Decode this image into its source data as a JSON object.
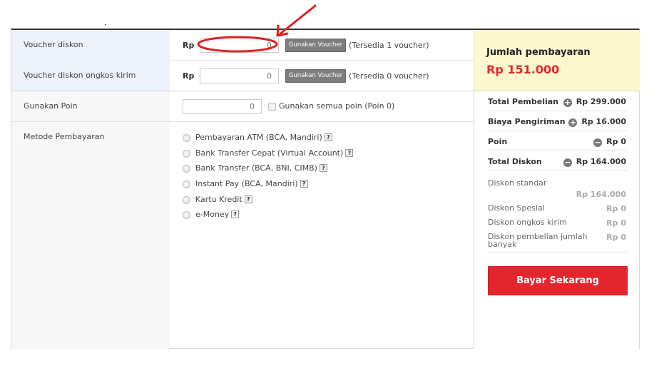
{
  "voucher": {
    "label": "Voucher diskon",
    "currency": "Rp",
    "value": "0",
    "button": "Gunakan Voucher",
    "note": "(Tersedia 1 voucher)"
  },
  "shipping_voucher": {
    "label": "Voucher diskon ongkos kirim",
    "currency": "Rp",
    "value": "0",
    "button": "Gunakan Voucher",
    "note": "(Tersedia 0 voucher)"
  },
  "points": {
    "label": "Gunakan Poin",
    "value": "0",
    "checkbox_label": "Gunakan semua poin (Poin 0)"
  },
  "payment": {
    "label": "Metode Pembayaran",
    "help_glyph": "?",
    "options": [
      "Pembayaran ATM (BCA, Mandiri)",
      "Bank Transfer Cepat (Virtual Account)",
      "Bank Transfer (BCA, BNI, CIMB)",
      "Instant Pay (BCA, Mandiri)",
      "Kartu Kredit",
      "e-Money"
    ]
  },
  "summary": {
    "title": "Jumlah pembayaran",
    "amount": "Rp 151.000",
    "total_pembelian_label": "Total Pembelian",
    "total_pembelian_value": "Rp 299.000",
    "biaya_label": "Biaya Pengiriman",
    "biaya_value": "Rp 16.000",
    "poin_label": "Poin",
    "poin_value": "Rp 0",
    "total_diskon_label": "Total Diskon",
    "total_diskon_value": "Rp 164.000",
    "plus_glyph": "+",
    "minus_glyph": "−",
    "discounts": {
      "standar_label": "Diskon standar",
      "standar_value": "Rp 164.000",
      "spesial_label": "Diskon Spesial",
      "spesial_value": "Rp 0",
      "ongkos_label": "Diskon ongkos kirim",
      "ongkos_value": "Rp 0",
      "jumlah_label": "Diskon pembelian jumlah banyak",
      "jumlah_value": "Rp 0"
    },
    "pay_button": "Bayar Sekarang"
  },
  "colors": {
    "accent_red": "#e3262e",
    "highlight_yellow": "#fdf7cf",
    "annotation_red": "#e02020"
  }
}
